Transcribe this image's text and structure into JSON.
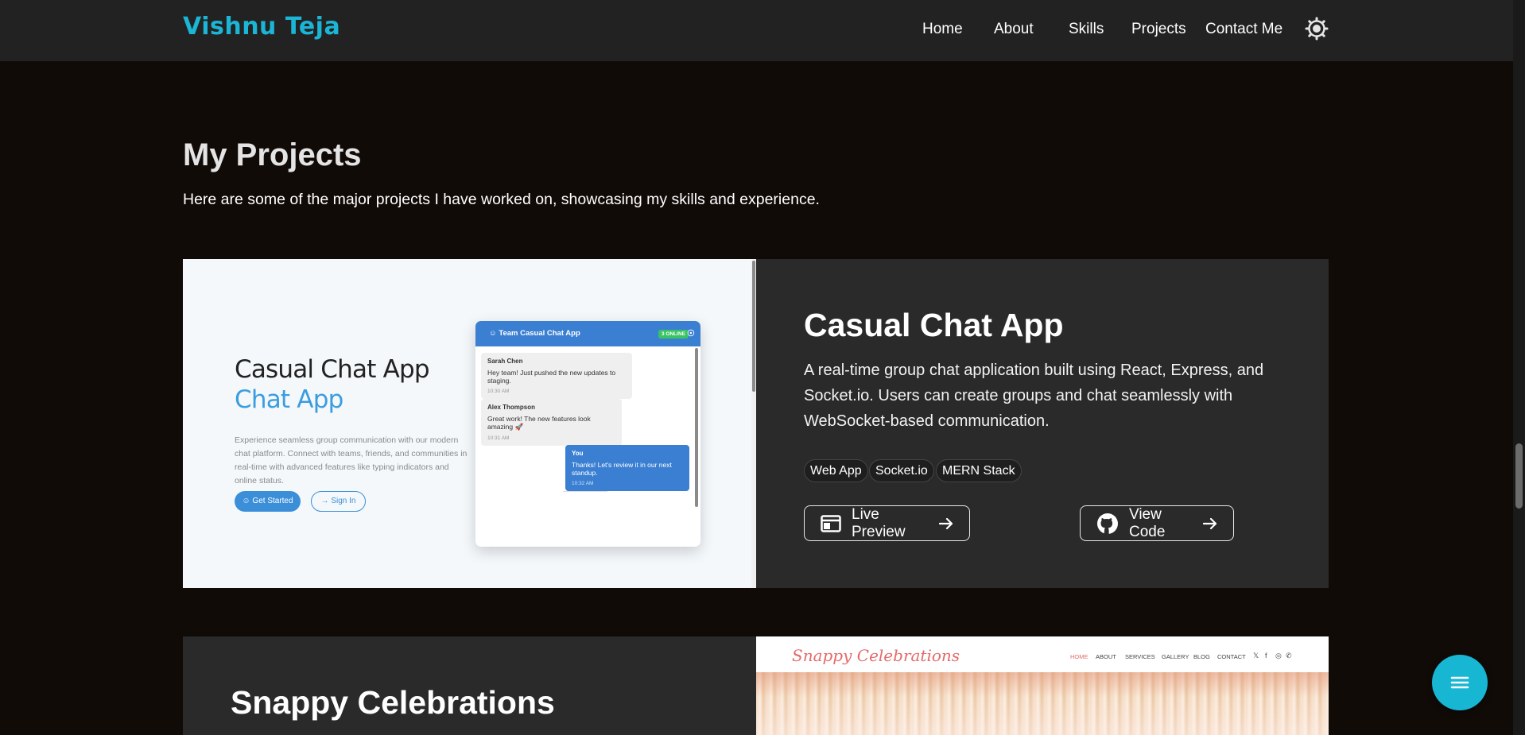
{
  "nav": {
    "brand": "Vishnu Teja",
    "links": [
      "Home",
      "About",
      "Skills",
      "Projects",
      "Contact Me"
    ],
    "theme_icon": "sun-icon"
  },
  "section": {
    "title": "My Projects",
    "subtitle": "Here are some of the major projects I have worked on, showcasing my skills and experience."
  },
  "projects": [
    {
      "title": "Casual Chat App",
      "description": "A real-time group chat application built using React, Express, and Socket.io. Users can create groups and chat seamlessly with WebSocket-based communication.",
      "tags": [
        "Web App",
        "Socket.io",
        "MERN Stack"
      ],
      "live_label": "Live Preview",
      "code_label": "View Code",
      "screenshot": {
        "title": "Casual Chat App",
        "title_accent": "Chat App",
        "description": "Experience seamless group communication with our modern chat platform. Connect with teams, friends, and communities in real-time with advanced features like typing indicators and online status.",
        "get_started": "Get Started",
        "sign_in": "Sign In",
        "chat_header": "Team Casual Chat App",
        "online_badge": "3 ONLINE",
        "messages": [
          {
            "name": "Sarah Chen",
            "text": "Hey team! Just pushed the new updates to staging.",
            "time": "10:30 AM"
          },
          {
            "name": "Alex Thompson",
            "text": "Great work! The new features look amazing 🚀",
            "time": "10:31 AM"
          },
          {
            "name": "You",
            "text": "Thanks! Let's review it in our next standup.",
            "time": "10:32 AM"
          }
        ]
      }
    },
    {
      "title": "Snappy Celebrations",
      "screenshot": {
        "logo": "Snappy Celebrations",
        "nav": [
          "HOME",
          "ABOUT",
          "SERVICES",
          "GALLERY",
          "BLOG",
          "CONTACT"
        ],
        "social": [
          "𝕏",
          "f",
          "◎",
          "✆"
        ]
      }
    }
  ],
  "fab": {
    "icon": "menu-icon"
  },
  "colors": {
    "accent": "#17b7d4",
    "navbar": "#222222",
    "page": "#110b08",
    "card": "#2a2a2a"
  }
}
